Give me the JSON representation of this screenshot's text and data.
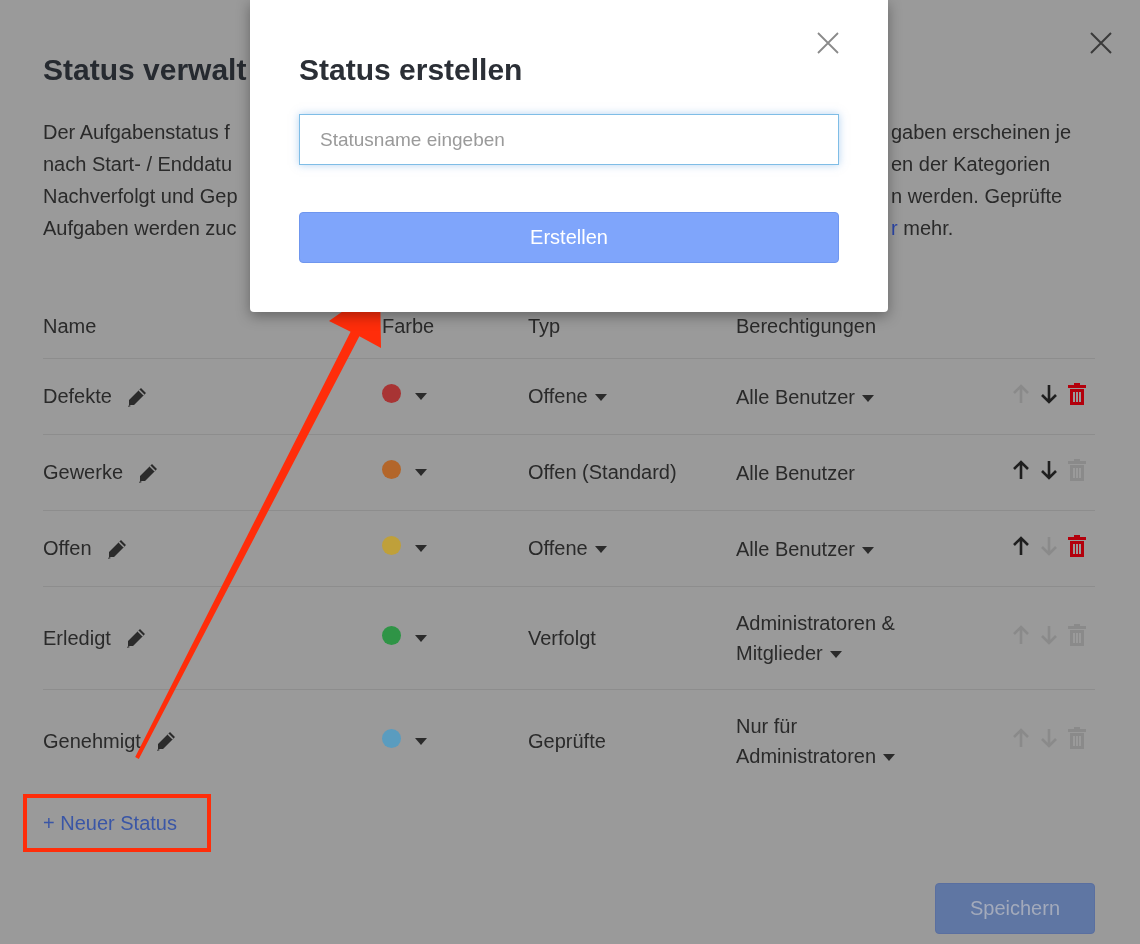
{
  "page": {
    "title": "Status verwalt"
  },
  "description": {
    "left_lines": [
      "Der Aufgabenstatus f",
      "nach Start- / Enddatu",
      "Nachverfolgt und Gep",
      "Aufgaben werden zuc"
    ],
    "right_lines": [
      {
        "text": "gaben erscheinen je"
      },
      {
        "text": "en der Kategorien"
      },
      {
        "text": "n werden. Geprüfte"
      },
      {
        "link": "r",
        "text": " mehr."
      }
    ]
  },
  "table": {
    "columns": [
      "Name",
      "Farbe",
      "Typ",
      "Berechtigungen"
    ],
    "rows": [
      {
        "name": "Defekte",
        "color": "#a83434",
        "type": "Offene",
        "type_dropdown": true,
        "permission": "Alle Benutzer",
        "permission_dropdown": true,
        "up_enabled": false,
        "down_enabled": true,
        "delete_enabled": true
      },
      {
        "name": "Gewerke",
        "color": "#b3662a",
        "type": "Offen (Standard)",
        "type_dropdown": false,
        "permission": "Alle Benutzer",
        "permission_dropdown": false,
        "up_enabled": true,
        "down_enabled": true,
        "delete_enabled": false
      },
      {
        "name": "Offen",
        "color": "#bfa03a",
        "type": "Offene",
        "type_dropdown": true,
        "permission": "Alle Benutzer",
        "permission_dropdown": true,
        "up_enabled": true,
        "down_enabled": false,
        "delete_enabled": true
      },
      {
        "name": "Erledigt",
        "color": "#2f9446",
        "type": "Verfolgt",
        "type_dropdown": false,
        "permission": "Administratoren & Mitglieder",
        "permission_dropdown": true,
        "up_enabled": false,
        "down_enabled": false,
        "delete_enabled": false
      },
      {
        "name": "Genehmigt",
        "color": "#5a9cbf",
        "type": "Geprüfte",
        "type_dropdown": false,
        "permission": "Nur für Administratoren",
        "permission_dropdown": true,
        "up_enabled": false,
        "down_enabled": false,
        "delete_enabled": false
      }
    ]
  },
  "add_link": "+ Neuer Status",
  "save_button": {
    "label": "Speichern",
    "disabled": true
  },
  "dialog": {
    "title": "Status erstellen",
    "input": {
      "placeholder": "Statusname eingeben"
    },
    "button": "Erstellen"
  }
}
